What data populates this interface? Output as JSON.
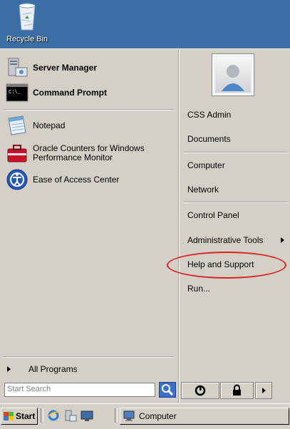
{
  "desktop": {
    "recycle_bin_label": "Recycle Bin"
  },
  "start_menu": {
    "pinned": [
      {
        "label": "Server Manager",
        "icon": "server-manager-icon"
      },
      {
        "label": "Command Prompt",
        "icon": "command-prompt-icon"
      }
    ],
    "recent": [
      {
        "label": "Notepad",
        "icon": "notepad-icon"
      },
      {
        "label_line1": "Oracle Counters for Windows",
        "label_line2": "Performance Monitor",
        "icon": "oracle-counters-icon"
      },
      {
        "label": "Ease of Access Center",
        "icon": "ease-of-access-icon"
      }
    ],
    "all_programs_label": "All Programs",
    "search_placeholder": "Start Search",
    "right": {
      "user_name": "CSS Admin",
      "items": [
        {
          "label": "Documents"
        },
        {
          "label": "Computer"
        },
        {
          "label": "Network"
        },
        {
          "label": "Control Panel"
        },
        {
          "label": "Administrative Tools",
          "has_submenu": true
        },
        {
          "label": "Help and Support"
        },
        {
          "label": "Run..."
        }
      ]
    },
    "highlight_color": "#e02020"
  },
  "taskbar": {
    "start_label": "Start",
    "task_label": "Computer"
  }
}
